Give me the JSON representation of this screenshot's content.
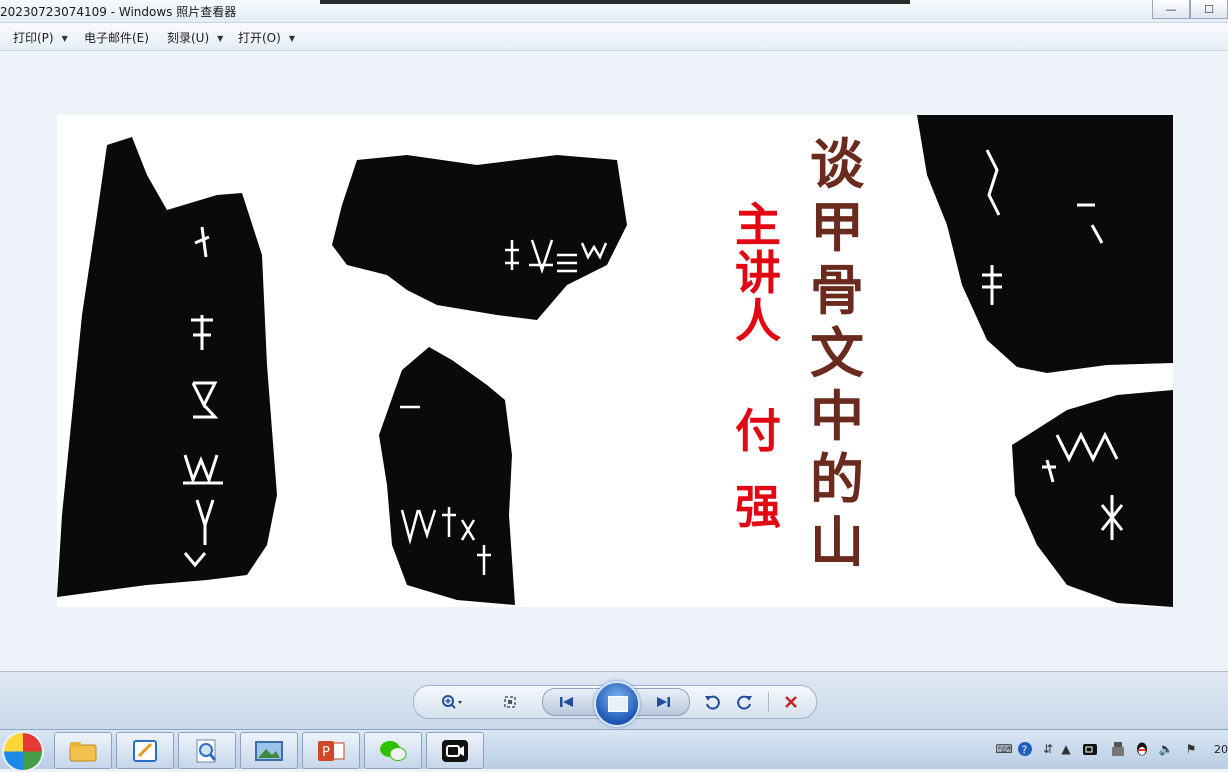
{
  "window": {
    "title": "20230723074109 - Windows 照片查看器",
    "minimize": "—",
    "maximize": "☐"
  },
  "menu": {
    "print": "打印(P)",
    "email": "电子邮件(E)",
    "burn": "刻录(U)",
    "open": "打开(O)"
  },
  "photo": {
    "title_chars": [
      "谈",
      "甲",
      "骨",
      "文",
      "中",
      "的",
      "山"
    ],
    "speaker_chars": [
      "主",
      "讲",
      "人"
    ],
    "name_chars": [
      "付",
      "强"
    ],
    "title_color": "#6b2a1e",
    "speaker_color": "#e30613"
  },
  "controls": {
    "zoom_icon": "magnifier-icon",
    "fit_icon": "actual-size-icon",
    "prev_icon": "previous-icon",
    "slideshow_icon": "slideshow-icon",
    "next_icon": "next-icon",
    "rotate_ccw_icon": "rotate-counterclockwise-icon",
    "rotate_cw_icon": "rotate-clockwise-icon",
    "delete_icon": "delete-icon"
  },
  "taskbar": {
    "clock": "20"
  }
}
